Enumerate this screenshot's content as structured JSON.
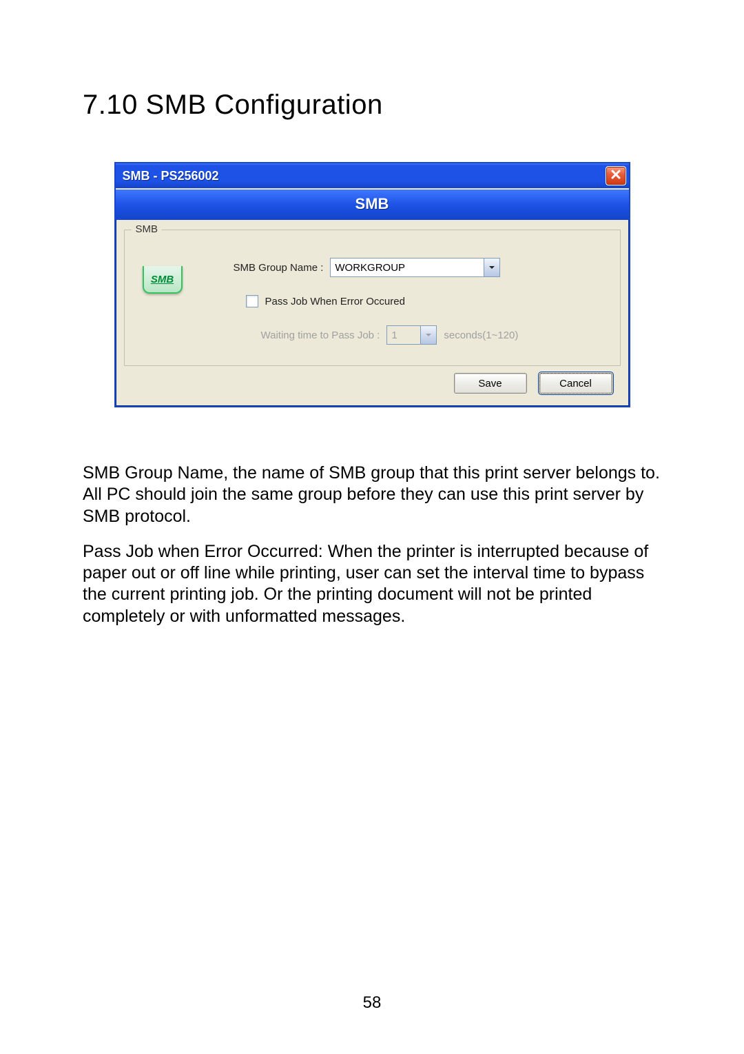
{
  "heading": "7.10  SMB Configuration",
  "dialog": {
    "title": "SMB - PS256002",
    "banner": "SMB",
    "group_legend": "SMB",
    "icon_text": "SMB",
    "group_name_label": "SMB Group Name :",
    "group_name_value": "WORKGROUP",
    "passjob_label": "Pass Job When Error Occured",
    "waiting_label": "Waiting time to Pass Job :",
    "waiting_value": "1",
    "waiting_suffix": "seconds(1~120)",
    "save_label": "Save",
    "cancel_label": "Cancel"
  },
  "para1": "SMB Group Name, the name of SMB group that this print server belongs to. All PC should join the same group before they can use this print server by SMB protocol.",
  "para2": "Pass Job when Error Occurred: When the printer is interrupted because of paper out or off line while printing, user can set the interval time to bypass the current printing job. Or the printing document will not be printed completely or with unformatted messages.",
  "page_number": "58"
}
